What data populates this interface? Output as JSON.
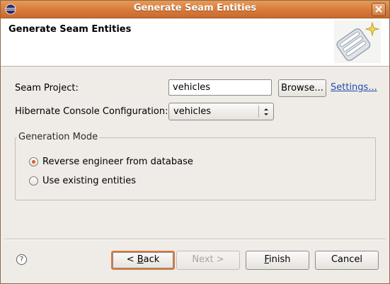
{
  "window": {
    "title": "Generate Seam Entities"
  },
  "banner": {
    "title": "Generate Seam Entities"
  },
  "form": {
    "seam_project_label": "Seam Project:",
    "seam_project_value": "vehicles",
    "browse_label": "Browse...",
    "settings_link": "Settings...",
    "hibernate_label": "Hibernate Console Configuration:",
    "hibernate_value": "vehicles"
  },
  "generation_mode": {
    "title": "Generation Mode",
    "options": [
      {
        "label": "Reverse engineer from database",
        "selected": true
      },
      {
        "label": "Use existing entities",
        "selected": false
      }
    ]
  },
  "buttons": {
    "help": "?",
    "back_prefix": "< ",
    "back_mnemonic": "B",
    "back_rest": "ack",
    "next_label": "Next >",
    "finish_mnemonic": "F",
    "finish_rest": "inish",
    "cancel_label": "Cancel"
  },
  "colors": {
    "titlebar": "#d77a3c",
    "accent": "#d4622a",
    "link": "#1d4fa9"
  },
  "icons": {
    "window": "eclipse-icon",
    "close": "close-icon",
    "banner": "seam-wizard-icon"
  }
}
